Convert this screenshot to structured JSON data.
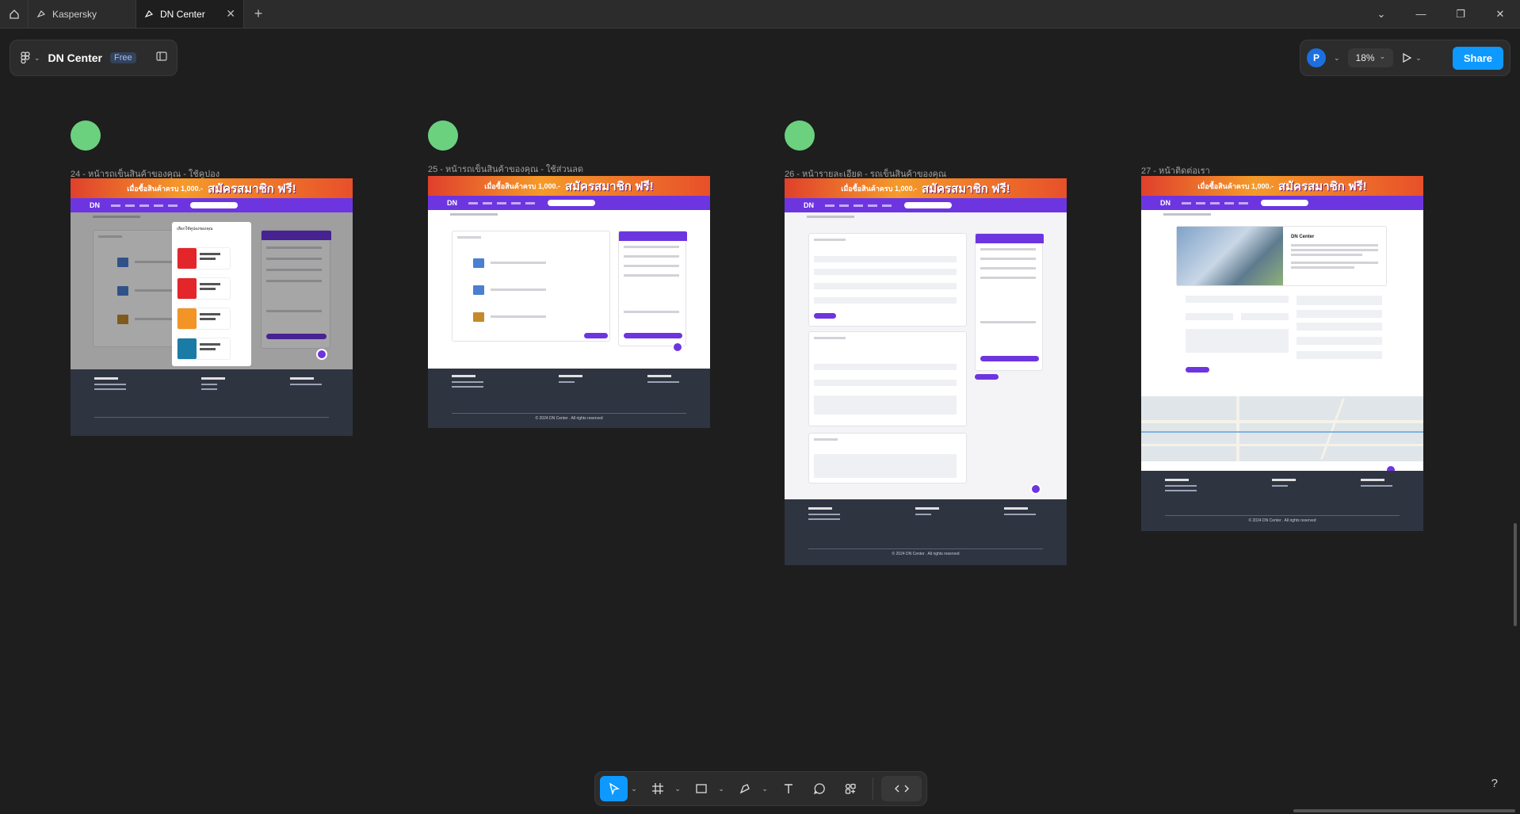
{
  "tabs": [
    {
      "label": "Kaspersky",
      "icon": "figma-file-icon",
      "active": false
    },
    {
      "label": "DN Center",
      "icon": "figma-file-icon",
      "active": true
    }
  ],
  "file": {
    "title": "DN Center",
    "plan_badge": "Free"
  },
  "header_right": {
    "avatar_initial": "P",
    "zoom": "18%",
    "share_label": "Share"
  },
  "frames": [
    {
      "label": "24 - หน้ารถเข็นสินค้าของคุณ - ใช้คูปอง",
      "modal_title": "เลือกใช้คูปองของคุณ"
    },
    {
      "label": "25 - หน้ารถเข็นสินค้าของคุณ - ใช้ส่วนลด",
      "footer_copyright": "© 2024 DN Center . All rights reserved"
    },
    {
      "label": "26 - หน้ารายละเอียด - รถเข็นสินค้าของคุณ",
      "footer_copyright": "© 2024 DN Center . All rights reserved"
    },
    {
      "label": "27 - หน้าติดต่อเรา",
      "company": "DN Center",
      "footer_copyright": "© 2024 DN Center . All rights reserved"
    }
  ],
  "banner": {
    "line1": "เมื่อซื้อสินค้าครบ 1,000.-",
    "line2": "สมัครสมาชิก ฟรี!"
  },
  "nav_logo": "DN",
  "footer": {
    "col1": "Get in Touch",
    "col2": "Learn More",
    "col3": "E-Mail"
  },
  "tools": [
    "move-tool",
    "frame-tool",
    "shape-tool",
    "pen-tool",
    "text-tool",
    "comment-tool",
    "actions-tool",
    "dev-mode-toggle"
  ],
  "help_label": "?"
}
